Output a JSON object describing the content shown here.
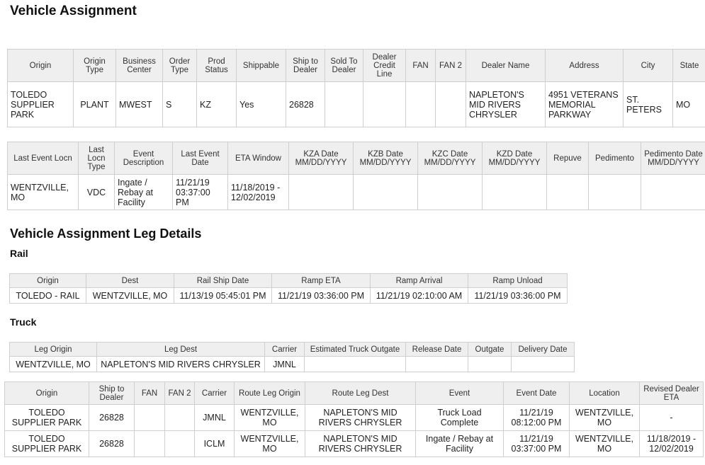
{
  "page_title": "Vehicle Assignment",
  "assignment": {
    "headers": [
      "Origin",
      "Origin Type",
      "Business Center",
      "Order Type",
      "Prod Status",
      "Shippable",
      "Ship to Dealer",
      "Sold To Dealer",
      "Dealer Credit Line",
      "FAN",
      "FAN 2",
      "Dealer Name",
      "Address",
      "City",
      "State"
    ],
    "row": [
      "TOLEDO SUPPLIER PARK",
      "PLANT",
      "MWEST",
      "S",
      "KZ",
      "Yes",
      "26828",
      "",
      "",
      "",
      "",
      "NAPLETON'S MID RIVERS CHRYSLER",
      "4951 VETERANS MEMORIAL PARKWAY",
      "ST. PETERS",
      "MO"
    ]
  },
  "events": {
    "headers": [
      "Last Event Locn",
      "Last Locn Type",
      "Event Description",
      "Last Event Date",
      "ETA Window",
      "KZA Date MM/DD/YYYY",
      "KZB Date MM/DD/YYYY",
      "KZC Date MM/DD/YYYY",
      "KZD Date MM/DD/YYYY",
      "Repuve",
      "Pedimento",
      "Pedimento Date MM/DD/YYYY"
    ],
    "row": [
      "WENTZVILLE, MO",
      "VDC",
      "Ingate / Rebay at Facility",
      "11/21/19 03:37:00 PM",
      "11/18/2019 - 12/02/2019",
      "",
      "",
      "",
      "",
      "",
      "",
      ""
    ]
  },
  "leg_title": "Vehicle Assignment Leg Details",
  "rail": {
    "title": "Rail",
    "headers": [
      "Origin",
      "Dest",
      "Rail Ship Date",
      "Ramp ETA",
      "Ramp Arrival",
      "Ramp Unload"
    ],
    "row": [
      "TOLEDO - RAIL",
      "WENTZVILLE, MO",
      "11/13/19 05:45:01 PM",
      "11/21/19 03:36:00 PM",
      "11/21/19 02:10:00 AM",
      "11/21/19 03:36:00 PM"
    ]
  },
  "truck": {
    "title": "Truck",
    "headers": [
      "Leg Origin",
      "Leg Dest",
      "Carrier",
      "Estimated Truck Outgate",
      "Release Date",
      "Outgate",
      "Delivery Date"
    ],
    "row": [
      "WENTZVILLE, MO",
      "NAPLETON'S MID RIVERS CHRYSLER",
      "JMNL",
      "",
      "",
      "",
      ""
    ]
  },
  "route": {
    "headers": [
      "Origin",
      "Ship to Dealer",
      "FAN",
      "FAN 2",
      "Carrier",
      "Route Leg Origin",
      "Route Leg Dest",
      "Event",
      "Event Date",
      "Location",
      "Revised Dealer ETA"
    ],
    "rows": [
      [
        "TOLEDO SUPPLIER PARK",
        "26828",
        "",
        "",
        "JMNL",
        "WENTZVILLE, MO",
        "NAPLETON'S MID RIVERS CHRYSLER",
        "Truck Load Complete",
        "11/21/19 08:12:00 PM",
        "WENTZVILLE, MO",
        "-"
      ],
      [
        "TOLEDO SUPPLIER PARK",
        "26828",
        "",
        "",
        "ICLM",
        "WENTZVILLE, MO",
        "NAPLETON'S MID RIVERS CHRYSLER",
        "Ingate / Rebay at Facility",
        "11/21/19 03:37:00 PM",
        "WENTZVILLE, MO",
        "11/18/2019 - 12/02/2019"
      ]
    ]
  }
}
